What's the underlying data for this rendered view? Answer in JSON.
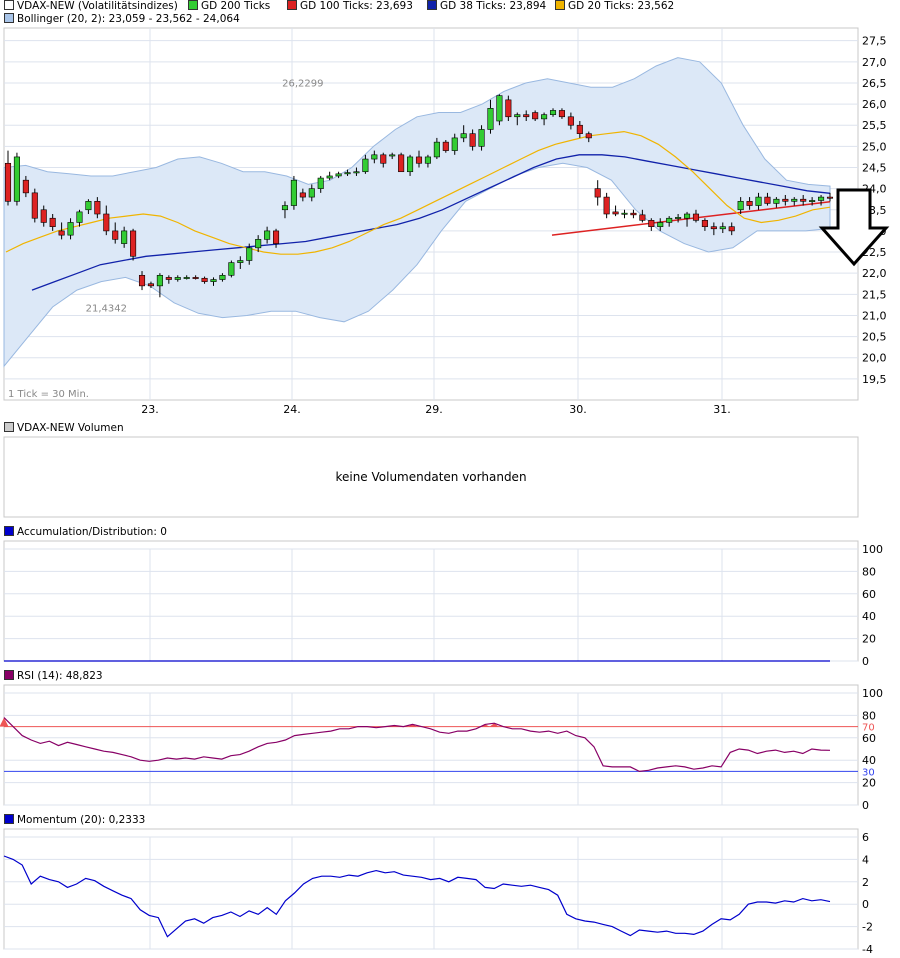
{
  "colors": {
    "grid": "#dde3ee",
    "panel_border": "#c8c8c8",
    "candle_up": "#33cc33",
    "candle_down": "#dd2222",
    "bollinger_fill": "#dce8f7",
    "bollinger_edge": "#99b8e0",
    "gd200": "#22aa22",
    "gd100": "#dd2222",
    "gd38": "#1122aa",
    "gd20": "#f0b400",
    "ad_line": "#0000cc",
    "rsi_line": "#880066",
    "rsi_upper": "#ee5555",
    "rsi_lower": "#3344ee",
    "momentum_line": "#0000cc"
  },
  "legends": {
    "row1": [
      {
        "label": "VDAX-NEW (Volatilitätsindizes)",
        "color": "#ffffff"
      },
      {
        "label": "GD 200 Ticks",
        "color": "#33cc33"
      },
      {
        "label": "GD 100 Ticks: 23,693",
        "color": "#dd2222"
      },
      {
        "label": "GD 38 Ticks: 23,894",
        "color": "#1122aa"
      },
      {
        "label": "GD 20 Ticks: 23,562",
        "color": "#f0b400"
      }
    ],
    "row2": {
      "label": "Bollinger (20, 2): 23,059 - 23,562 - 24,064",
      "color": "#a8c4e8"
    },
    "volume": {
      "label": "VDAX-NEW Volumen",
      "color": "#cccccc"
    },
    "ad": {
      "label": "Accumulation/Distribution: 0",
      "color": "#0000cc"
    },
    "rsi": {
      "label": "RSI (14): 48,823",
      "color": "#880066"
    },
    "momentum": {
      "label": "Momentum (20): 0,2333",
      "color": "#0000cc"
    }
  },
  "volume_panel": {
    "message": "keine Volumendaten vorhanden"
  },
  "chart_data": [
    {
      "type": "candlestick",
      "title": "VDAX-NEW (Volatilitätsindizes)",
      "note": "1 Tick = 30 Min.",
      "x_tick_labels": [
        "23.",
        "24.",
        "29.",
        "30.",
        "31."
      ],
      "x_tick_index": [
        10,
        20,
        30,
        40,
        50
      ],
      "ylim": [
        19.0,
        27.8
      ],
      "y_ticks": [
        "19,5",
        "20,0",
        "20,5",
        "21,0",
        "21,5",
        "22,0",
        "22,5",
        "23,0",
        "23,5",
        "24,0",
        "24,5",
        "25,0",
        "25,5",
        "26,0",
        "26,5",
        "27,0",
        "27,5"
      ],
      "annotations": [
        {
          "text": "26,2299",
          "index": 33,
          "value": 26.23
        },
        {
          "text": "21,4342",
          "index": 11,
          "value": 21.43
        }
      ],
      "candles": [
        [
          24.6,
          24.9,
          23.6,
          23.7
        ],
        [
          23.7,
          24.85,
          23.6,
          24.75
        ],
        [
          24.2,
          24.3,
          23.8,
          23.9
        ],
        [
          23.9,
          24.0,
          23.2,
          23.3
        ],
        [
          23.5,
          23.6,
          23.1,
          23.2
        ],
        [
          23.3,
          23.4,
          23.0,
          23.1
        ],
        [
          23.0,
          23.2,
          22.8,
          22.9
        ],
        [
          22.9,
          23.3,
          22.8,
          23.2
        ],
        [
          23.2,
          23.5,
          23.1,
          23.45
        ],
        [
          23.5,
          23.75,
          23.4,
          23.7
        ],
        [
          23.7,
          23.8,
          23.3,
          23.4
        ],
        [
          23.4,
          23.6,
          22.9,
          23.0
        ],
        [
          23.0,
          23.2,
          22.7,
          22.8
        ],
        [
          22.7,
          23.1,
          22.6,
          23.0
        ],
        [
          23.0,
          23.05,
          22.3,
          22.4
        ],
        [
          21.95,
          22.05,
          21.6,
          21.7
        ],
        [
          21.75,
          21.8,
          21.65,
          21.7
        ],
        [
          21.7,
          22.0,
          21.43,
          21.95
        ],
        [
          21.9,
          21.95,
          21.75,
          21.85
        ],
        [
          21.85,
          21.95,
          21.8,
          21.9
        ],
        [
          21.9,
          21.95,
          21.85,
          21.9
        ],
        [
          21.9,
          21.95,
          21.85,
          21.88
        ],
        [
          21.88,
          21.92,
          21.75,
          21.8
        ],
        [
          21.8,
          21.9,
          21.7,
          21.85
        ],
        [
          21.85,
          22.0,
          21.8,
          21.95
        ],
        [
          21.95,
          22.3,
          21.9,
          22.25
        ],
        [
          22.25,
          22.4,
          22.1,
          22.3
        ],
        [
          22.3,
          22.7,
          22.2,
          22.6
        ],
        [
          22.6,
          22.9,
          22.5,
          22.8
        ],
        [
          22.8,
          23.1,
          22.7,
          23.0
        ],
        [
          23.0,
          23.05,
          22.6,
          22.7
        ],
        [
          23.5,
          23.7,
          23.3,
          23.6
        ],
        [
          23.6,
          24.3,
          23.5,
          24.2
        ],
        [
          23.9,
          24.0,
          23.7,
          23.8
        ],
        [
          23.8,
          24.1,
          23.7,
          24.0
        ],
        [
          24.0,
          24.3,
          23.9,
          24.25
        ],
        [
          24.25,
          24.4,
          24.2,
          24.3
        ],
        [
          24.3,
          24.4,
          24.25,
          24.35
        ],
        [
          24.35,
          24.45,
          24.3,
          24.38
        ],
        [
          24.38,
          24.5,
          24.3,
          24.4
        ],
        [
          24.4,
          24.8,
          24.35,
          24.7
        ],
        [
          24.7,
          24.9,
          24.6,
          24.8
        ],
        [
          24.8,
          24.85,
          24.5,
          24.6
        ],
        [
          24.8,
          24.85,
          24.7,
          24.8
        ],
        [
          24.8,
          24.85,
          24.5,
          24.4
        ],
        [
          24.4,
          24.8,
          24.3,
          24.75
        ],
        [
          24.75,
          24.9,
          24.5,
          24.6
        ],
        [
          24.6,
          24.8,
          24.5,
          24.75
        ],
        [
          24.75,
          25.2,
          24.7,
          25.1
        ],
        [
          25.1,
          25.15,
          24.85,
          24.9
        ],
        [
          24.9,
          25.3,
          24.8,
          25.2
        ],
        [
          25.2,
          25.5,
          25.1,
          25.3
        ],
        [
          25.3,
          25.4,
          24.9,
          25.0
        ],
        [
          25.0,
          25.5,
          24.9,
          25.4
        ],
        [
          25.4,
          26.1,
          25.3,
          25.9
        ],
        [
          25.6,
          26.23,
          25.5,
          26.2
        ],
        [
          26.1,
          26.2,
          25.6,
          25.7
        ]
      ],
      "candles_b": [
        [
          25.7,
          25.8,
          25.5,
          25.75
        ],
        [
          25.75,
          25.85,
          25.6,
          25.7
        ],
        [
          25.8,
          25.85,
          25.6,
          25.65
        ],
        [
          25.65,
          25.8,
          25.5,
          25.75
        ],
        [
          25.75,
          25.9,
          25.7,
          25.85
        ],
        [
          25.85,
          25.9,
          25.65,
          25.7
        ],
        [
          25.7,
          25.8,
          25.4,
          25.5
        ],
        [
          25.5,
          25.6,
          25.2,
          25.3
        ],
        [
          25.3,
          25.35,
          25.1,
          25.2
        ],
        [
          24.0,
          24.2,
          23.6,
          23.8
        ],
        [
          23.8,
          23.9,
          23.3,
          23.4
        ],
        [
          23.45,
          23.6,
          23.35,
          23.4
        ],
        [
          23.4,
          23.5,
          23.3,
          23.42
        ],
        [
          23.42,
          23.5,
          23.3,
          23.38
        ],
        [
          23.38,
          23.5,
          23.2,
          23.25
        ],
        [
          23.25,
          23.3,
          23.0,
          23.1
        ],
        [
          23.1,
          23.3,
          23.0,
          23.2
        ],
        [
          23.2,
          23.35,
          23.1,
          23.3
        ],
        [
          23.3,
          23.4,
          23.2,
          23.32
        ],
        [
          23.3,
          23.45,
          23.1,
          23.4
        ],
        [
          23.4,
          23.5,
          23.2,
          23.25
        ],
        [
          23.25,
          23.3,
          23.0,
          23.1
        ],
        [
          23.1,
          23.2,
          22.9,
          23.05
        ],
        [
          23.05,
          23.2,
          22.95,
          23.1
        ],
        [
          23.1,
          23.2,
          22.9,
          23.0
        ],
        [
          23.5,
          23.8,
          23.4,
          23.7
        ],
        [
          23.7,
          23.8,
          23.5,
          23.6
        ],
        [
          23.6,
          23.9,
          23.5,
          23.8
        ],
        [
          23.8,
          23.9,
          23.6,
          23.65
        ],
        [
          23.65,
          23.8,
          23.55,
          23.75
        ],
        [
          23.75,
          23.85,
          23.6,
          23.7
        ],
        [
          23.7,
          23.8,
          23.6,
          23.75
        ],
        [
          23.75,
          23.85,
          23.6,
          23.7
        ],
        [
          23.7,
          23.8,
          23.6,
          23.72
        ],
        [
          23.72,
          23.85,
          23.6,
          23.8
        ],
        [
          23.8,
          23.9,
          23.7,
          23.78
        ]
      ],
      "gd20": [
        22.5,
        22.7,
        22.85,
        23.0,
        23.1,
        23.2,
        23.3,
        23.35,
        23.4,
        23.35,
        23.2,
        23.0,
        22.85,
        22.7,
        22.6,
        22.5,
        22.45,
        22.45,
        22.5,
        22.6,
        22.75,
        22.95,
        23.15,
        23.3,
        23.5,
        23.7,
        23.9,
        24.1,
        24.3,
        24.5,
        24.7,
        24.9,
        25.05,
        25.15,
        25.25,
        25.3,
        25.35,
        25.25,
        25.05,
        24.75,
        24.4,
        24.0,
        23.6,
        23.3,
        23.2,
        23.25,
        23.35,
        23.5,
        23.56
      ],
      "gd38": [
        21.6,
        21.8,
        22.0,
        22.2,
        22.3,
        22.4,
        22.45,
        22.5,
        22.55,
        22.6,
        22.65,
        22.7,
        22.75,
        22.85,
        22.95,
        23.05,
        23.15,
        23.3,
        23.5,
        23.75,
        24.0,
        24.25,
        24.5,
        24.7,
        24.8,
        24.8,
        24.75,
        24.65,
        24.55,
        24.45,
        24.35,
        24.25,
        24.15,
        24.05,
        23.95,
        23.89
      ],
      "gd100": [
        22.9,
        23.69
      ],
      "boll_upper": [
        24.5,
        24.55,
        24.4,
        24.35,
        24.3,
        24.3,
        24.4,
        24.5,
        24.7,
        24.75,
        24.6,
        24.4,
        24.4,
        24.3,
        24.1,
        24.2,
        24.5,
        25.0,
        25.4,
        25.7,
        25.8,
        25.8,
        26.0,
        26.3,
        26.5,
        26.6,
        26.5,
        26.4,
        26.4,
        26.6,
        26.9,
        27.1,
        27.0,
        26.5,
        25.5,
        24.7,
        24.2,
        24.1,
        24.06
      ],
      "boll_lower": [
        19.8,
        20.5,
        21.2,
        21.6,
        21.8,
        21.9,
        21.7,
        21.3,
        21.05,
        20.95,
        21.0,
        21.1,
        21.1,
        20.95,
        20.85,
        21.1,
        21.6,
        22.2,
        23.0,
        23.7,
        24.0,
        24.3,
        24.5,
        24.6,
        24.5,
        24.2,
        23.5,
        23.0,
        22.7,
        22.5,
        22.6,
        23.0,
        23.0,
        23.0,
        23.06
      ]
    },
    {
      "type": "line",
      "title": "Accumulation/Distribution: 0",
      "ylim": [
        0,
        100
      ],
      "y_ticks": [
        "0",
        "20",
        "40",
        "60",
        "80",
        "100"
      ],
      "values": [
        0,
        0
      ]
    },
    {
      "type": "line",
      "title": "RSI (14): 48,823",
      "ylim": [
        0,
        100
      ],
      "y_ticks": [
        "0",
        "20",
        "40",
        "60",
        "80",
        "100"
      ],
      "upper_band": 70,
      "lower_band": 30,
      "upper_label": "70",
      "lower_label": "30",
      "values": [
        78,
        70,
        62,
        58,
        55,
        57,
        53,
        56,
        54,
        52,
        50,
        48,
        47,
        45,
        43,
        40,
        39,
        40,
        42,
        41,
        42,
        41,
        43,
        42,
        41,
        44,
        45,
        48,
        52,
        55,
        56,
        58,
        62,
        63,
        64,
        65,
        66,
        68,
        68,
        70,
        70,
        69,
        70,
        71,
        70,
        72,
        70,
        68,
        65,
        64,
        66,
        66,
        68,
        72,
        73,
        70,
        68,
        68,
        66,
        65,
        66,
        64,
        66,
        62,
        60,
        52,
        35,
        34,
        34,
        34,
        30,
        31,
        33,
        34,
        35,
        34,
        32,
        33,
        35,
        34,
        47,
        50,
        49,
        46,
        48,
        49,
        47,
        48,
        46,
        50,
        49,
        48.8
      ]
    },
    {
      "type": "line",
      "title": "Momentum (20): 0,2333",
      "ylim": [
        -4,
        6
      ],
      "y_ticks": [
        "-4",
        "-2",
        "0",
        "2",
        "4",
        "6"
      ],
      "values": [
        4.3,
        4.0,
        3.5,
        1.8,
        2.5,
        2.2,
        2.0,
        1.5,
        1.8,
        2.3,
        2.1,
        1.6,
        1.2,
        0.8,
        0.5,
        -0.5,
        -1.0,
        -1.2,
        -2.9,
        -2.2,
        -1.5,
        -1.3,
        -1.7,
        -1.2,
        -1.0,
        -0.7,
        -1.1,
        -0.6,
        -0.9,
        -0.3,
        -0.9,
        0.3,
        1.0,
        1.8,
        2.3,
        2.5,
        2.5,
        2.4,
        2.6,
        2.5,
        2.8,
        3.0,
        2.8,
        2.9,
        2.6,
        2.5,
        2.4,
        2.2,
        2.3,
        2.0,
        2.4,
        2.3,
        2.2,
        1.5,
        1.4,
        1.8,
        1.7,
        1.6,
        1.7,
        1.5,
        1.3,
        0.8,
        -0.9,
        -1.3,
        -1.5,
        -1.6,
        -1.8,
        -2.0,
        -2.4,
        -2.8,
        -2.3,
        -2.4,
        -2.5,
        -2.4,
        -2.6,
        -2.6,
        -2.7,
        -2.4,
        -1.8,
        -1.3,
        -1.4,
        -0.9,
        0.0,
        0.2,
        0.2,
        0.1,
        0.3,
        0.2,
        0.5,
        0.3,
        0.4,
        0.23
      ]
    }
  ]
}
